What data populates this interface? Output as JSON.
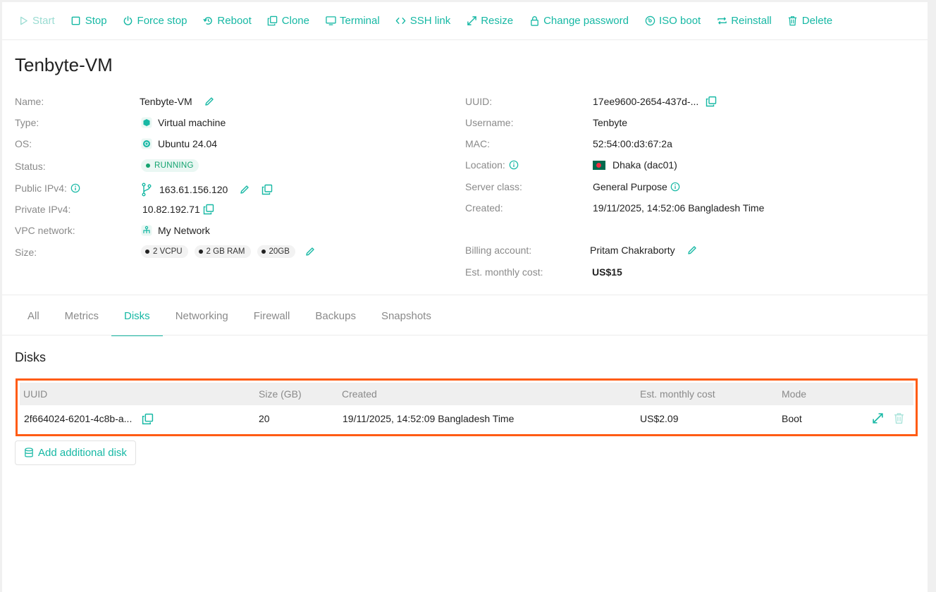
{
  "toolbar": {
    "start": "Start",
    "stop": "Stop",
    "force_stop": "Force stop",
    "reboot": "Reboot",
    "clone": "Clone",
    "terminal": "Terminal",
    "ssh_link": "SSH link",
    "resize": "Resize",
    "change_password": "Change password",
    "iso_boot": "ISO boot",
    "reinstall": "Reinstall",
    "delete": "Delete"
  },
  "vm": {
    "title": "Tenbyte-VM",
    "labels": {
      "name": "Name:",
      "type": "Type:",
      "os": "OS:",
      "status": "Status:",
      "public_ipv4": "Public IPv4:",
      "private_ipv4": "Private IPv4:",
      "vpc": "VPC network:",
      "size": "Size:",
      "uuid": "UUID:",
      "username": "Username:",
      "mac": "MAC:",
      "location": "Location:",
      "server_class": "Server class:",
      "created": "Created:",
      "billing": "Billing account:",
      "cost": "Est. monthly cost:"
    },
    "values": {
      "name": "Tenbyte-VM",
      "type": "Virtual machine",
      "os": "Ubuntu 24.04",
      "status": "RUNNING",
      "public_ipv4": "163.61.156.120",
      "private_ipv4": "10.82.192.71",
      "vpc": "My Network",
      "size_vcpu": "2 VCPU",
      "size_ram": "2 GB RAM",
      "size_disk": "20GB",
      "uuid": "17ee9600-2654-437d-...",
      "username": "Tenbyte",
      "mac": "52:54:00:d3:67:2a",
      "location": "Dhaka (dac01)",
      "server_class": "General Purpose",
      "created": "19/11/2025, 14:52:06 Bangladesh Time",
      "billing": "Pritam Chakraborty",
      "cost": "US$15"
    }
  },
  "tabs": [
    "All",
    "Metrics",
    "Disks",
    "Networking",
    "Firewall",
    "Backups",
    "Snapshots"
  ],
  "active_tab": "Disks",
  "disks": {
    "title": "Disks",
    "columns": [
      "UUID",
      "Size (GB)",
      "Created",
      "Est. monthly cost",
      "Mode"
    ],
    "rows": [
      {
        "uuid": "2f664024-6201-4c8b-a...",
        "size": "20",
        "created": "19/11/2025, 14:52:09 Bangladesh Time",
        "cost": "US$2.09",
        "mode": "Boot"
      }
    ],
    "add_label": "Add additional disk"
  },
  "colors": {
    "accent": "#16b8a4",
    "highlight_border": "#ff5c14",
    "status_green": "#13a36f"
  }
}
